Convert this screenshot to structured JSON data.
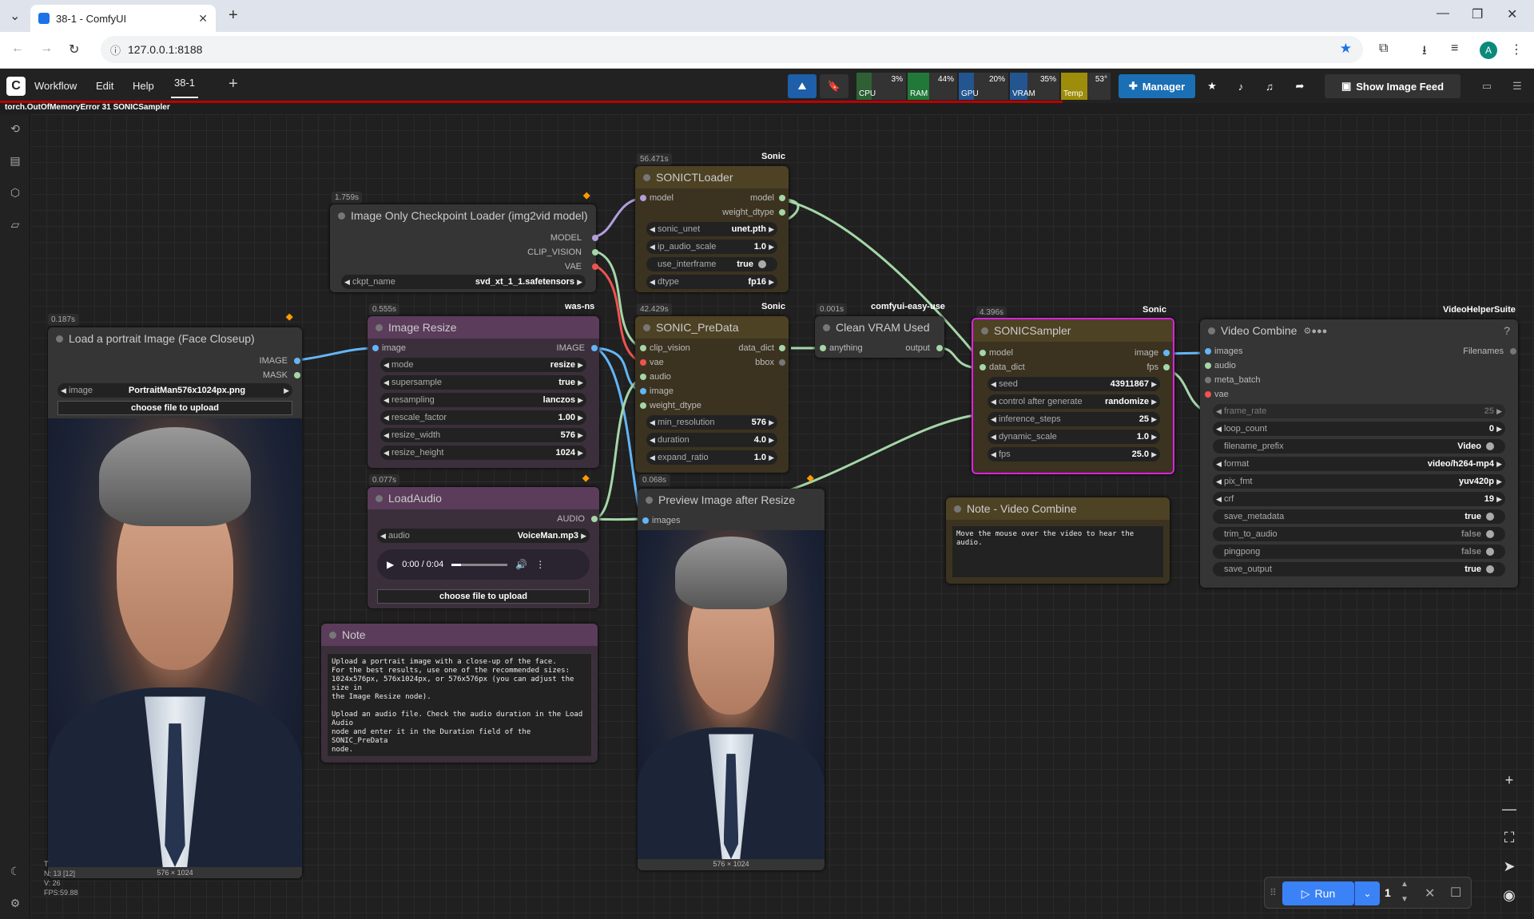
{
  "browser": {
    "tab_title": "38-1 - ComfyUI",
    "url": "127.0.0.1:8188",
    "new_tab": "+"
  },
  "menu": {
    "workflow": "Workflow",
    "edit": "Edit",
    "help": "Help",
    "tab": "38-1",
    "add": "+"
  },
  "stats": [
    {
      "label": "CPU",
      "pct": "3%",
      "color": "#2e6b34"
    },
    {
      "label": "RAM",
      "pct": "44%",
      "color": "#1d8a3a"
    },
    {
      "label": "GPU",
      "pct": "20%",
      "color": "#1f5ea8"
    },
    {
      "label": "VRAM",
      "pct": "35%",
      "color": "#1f5ea8"
    },
    {
      "label": "Temp",
      "pct": "53°",
      "color": "#b8a400"
    }
  ],
  "buttons": {
    "manager": "Manager",
    "show_feed": "Show Image Feed",
    "run": "Run",
    "queue_count": "1"
  },
  "error": "torch.OutOfMemoryError 31 SONICSampler",
  "footer": {
    "n": "N: 13 [12]",
    "v": "V: 26",
    "fps": "FPS:59.88",
    "t": "T"
  },
  "nodes": {
    "ckpt": {
      "time": "1.759s",
      "title": "Image Only Checkpoint Loader (img2vid model)",
      "outs": [
        "MODEL",
        "CLIP_VISION",
        "VAE"
      ],
      "w_label": "ckpt_name",
      "w_val": "svd_xt_1_1.safetensors"
    },
    "sonicloader": {
      "time": "56.471s",
      "tag": "Sonic",
      "title": "SONICTLoader",
      "in": "model",
      "outs": [
        "model",
        "weight_dtype"
      ],
      "widgets": [
        [
          "sonic_unet",
          "unet.pth"
        ],
        [
          "ip_audio_scale",
          "1.0"
        ],
        [
          "use_interframe",
          "true"
        ],
        [
          "dtype",
          "fp16"
        ]
      ]
    },
    "loadimg": {
      "time": "0.187s",
      "title": "Load a portrait Image (Face Closeup)",
      "outs": [
        "IMAGE",
        "MASK"
      ],
      "w_label": "image",
      "w_val": "PortraitMan576x1024px.png",
      "upload": "choose file to upload",
      "cap": "576 × 1024"
    },
    "resize": {
      "time": "0.555s",
      "tag": "was-ns",
      "title": "Image Resize",
      "in": "image",
      "out": "IMAGE",
      "widgets": [
        [
          "mode",
          "resize"
        ],
        [
          "supersample",
          "true"
        ],
        [
          "resampling",
          "lanczos"
        ],
        [
          "rescale_factor",
          "1.00"
        ],
        [
          "resize_width",
          "576"
        ],
        [
          "resize_height",
          "1024"
        ]
      ]
    },
    "predata": {
      "time": "42.429s",
      "tag": "Sonic",
      "title": "SONIC_PreData",
      "ins": [
        "clip_vision",
        "vae",
        "audio",
        "image",
        "weight_dtype"
      ],
      "outs": [
        "data_dict",
        "bbox"
      ],
      "widgets": [
        [
          "min_resolution",
          "576"
        ],
        [
          "duration",
          "4.0"
        ],
        [
          "expand_ratio",
          "1.0"
        ]
      ]
    },
    "cleanvram": {
      "time": "0.001s",
      "tag": "comfyui-easy-use",
      "title": "Clean VRAM Used",
      "in": "anything",
      "out": "output"
    },
    "sampler": {
      "time": "4.396s",
      "tag": "Sonic",
      "title": "SONICSampler",
      "ins": [
        "model",
        "data_dict"
      ],
      "outs": [
        "image",
        "fps"
      ],
      "widgets": [
        [
          "seed",
          "43911867"
        ],
        [
          "control after generate",
          "randomize"
        ],
        [
          "inference_steps",
          "25"
        ],
        [
          "dynamic_scale",
          "1.0"
        ],
        [
          "fps",
          "25.0"
        ]
      ]
    },
    "combine": {
      "tag": "VideoHelperSuite",
      "title": "Video Combine",
      "help": "?",
      "ins": [
        "images",
        "audio",
        "meta_batch",
        "vae"
      ],
      "out": "Filenames",
      "widgets": [
        [
          "frame_rate",
          "25"
        ],
        [
          "loop_count",
          "0"
        ],
        [
          "filename_prefix",
          "Video"
        ],
        [
          "format",
          "video/h264-mp4"
        ],
        [
          "pix_fmt",
          "yuv420p"
        ],
        [
          "crf",
          "19"
        ],
        [
          "save_metadata",
          "true"
        ],
        [
          "trim_to_audio",
          "false"
        ],
        [
          "pingpong",
          "false"
        ],
        [
          "save_output",
          "true"
        ]
      ]
    },
    "loadaudio": {
      "time": "0.077s",
      "title": "LoadAudio",
      "out": "AUDIO",
      "w_label": "audio",
      "w_val": "VoiceMan.mp3",
      "player": "0:00 / 0:04",
      "upload": "choose file to upload"
    },
    "preview": {
      "time": "0.068s",
      "title": "Preview Image after Resize",
      "in": "images",
      "cap": "576 × 1024"
    },
    "note": {
      "title": "Note",
      "text": "Upload a portrait image with a close-up of the face.\nFor the best results, use one of the recommended sizes:\n1024x576px, 576x1024px, or 576x576px (you can adjust the size in\nthe Image Resize node).\n\nUpload an audio file. Check the audio duration in the Load Audio\nnode and enter it in the Duration field of the SONIC_PreData\nnode."
    },
    "notevc": {
      "title": "Note - Video Combine",
      "text": "Move the mouse over the video to hear the audio."
    }
  }
}
